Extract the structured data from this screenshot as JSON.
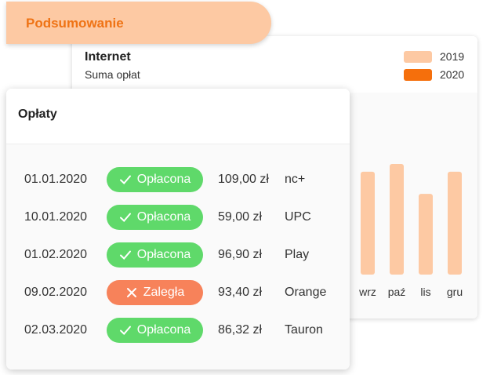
{
  "tab": {
    "label": "Podsumowanie"
  },
  "summary_card": {
    "title": "Internet",
    "subtitle": "Suma opłat",
    "legend": [
      {
        "label": "2019",
        "color": "#fdc9a3"
      },
      {
        "label": "2020",
        "color": "#f56f0c"
      }
    ]
  },
  "chart_data": {
    "type": "bar",
    "categories": [
      "wrz",
      "paź",
      "lis",
      "gru"
    ],
    "series": [
      {
        "name": "2019",
        "values": [
          0.93,
          1.0,
          0.73,
          0.93
        ]
      }
    ],
    "title": "",
    "xlabel": "",
    "ylabel": "",
    "grid": false,
    "legend_position": "top-right"
  },
  "payments_card": {
    "title": "Opłaty",
    "status_colors": {
      "paid": "#5fd96a",
      "overdue": "#f7825a"
    },
    "rows": [
      {
        "date": "01.01.2020",
        "status": "Opłacona",
        "status_type": "paid",
        "status_icon": "check-icon",
        "amount": "109,00 zł",
        "provider": "nc+"
      },
      {
        "date": "10.01.2020",
        "status": "Opłacona",
        "status_type": "paid",
        "status_icon": "check-icon",
        "amount": "59,00 zł",
        "provider": "UPC"
      },
      {
        "date": "01.02.2020",
        "status": "Opłacona",
        "status_type": "paid",
        "status_icon": "check-icon",
        "amount": "96,90 zł",
        "provider": "Play"
      },
      {
        "date": "09.02.2020",
        "status": "Zaległa",
        "status_type": "overdue",
        "status_icon": "cross-icon",
        "amount": "93,40 zł",
        "provider": "Orange"
      },
      {
        "date": "02.03.2020",
        "status": "Opłacona",
        "status_type": "paid",
        "status_icon": "check-icon",
        "amount": "86,32 zł",
        "provider": "Tauron"
      }
    ]
  }
}
